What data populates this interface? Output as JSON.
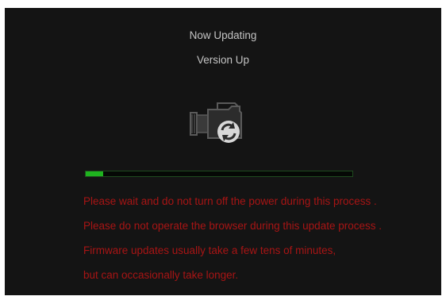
{
  "header": {
    "title": "Now Updating",
    "subtitle": "Version Up"
  },
  "icon": {
    "name": "camera-update-icon"
  },
  "progress": {
    "fraction": 0.065
  },
  "messages": [
    "Please wait and do not turn off the power during this process .",
    "Please do not operate the browser during this update process .",
    "Firmware updates usually take a few tens of minutes,",
    "but can occasionally take longer."
  ],
  "colors": {
    "background": "#141414",
    "title_text": "#c4c4c4",
    "warning_text": "#a81414",
    "progress_fill": "#1fb41f",
    "progress_border": "#1f4a1f"
  }
}
